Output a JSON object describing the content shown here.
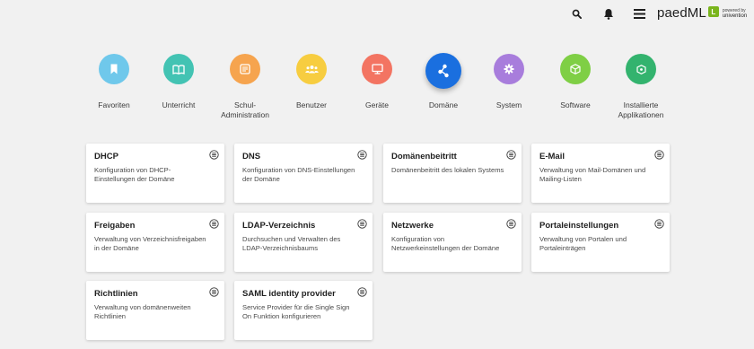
{
  "header": {
    "logo_text": "paedML",
    "logo_badge": "L",
    "powered_line1": "powered by",
    "powered_line2": "univention"
  },
  "categories": [
    {
      "label": "Favoriten",
      "color": "#6fc8eb",
      "icon": "bookmark-icon"
    },
    {
      "label": "Unterricht",
      "color": "#43c3b3",
      "icon": "book-icon"
    },
    {
      "label": "Schul-\nAdministration",
      "color": "#f6a44e",
      "icon": "admin-icon"
    },
    {
      "label": "Benutzer",
      "color": "#f7cd40",
      "icon": "users-icon"
    },
    {
      "label": "Geräte",
      "color": "#f37462",
      "icon": "monitor-icon"
    },
    {
      "label": "Domäne",
      "color": "#1a6fdf",
      "icon": "share-icon",
      "active": true
    },
    {
      "label": "System",
      "color": "#a87ddc",
      "icon": "gear-icon"
    },
    {
      "label": "Software",
      "color": "#7fcf45",
      "icon": "box-icon"
    },
    {
      "label": "Installierte\nApplikationen",
      "color": "#33b36e",
      "icon": "app-icon"
    }
  ],
  "tiles": [
    {
      "title": "DHCP",
      "desc": "Konfiguration von DHCP-Einstellungen der Domäne"
    },
    {
      "title": "DNS",
      "desc": "Konfiguration von DNS-Einstellungen der Domäne"
    },
    {
      "title": "Domänenbeitritt",
      "desc": "Domänenbeitritt des lokalen Systems"
    },
    {
      "title": "E-Mail",
      "desc": "Verwaltung von Mail-Domänen und Mailing-Listen"
    },
    {
      "title": "Freigaben",
      "desc": "Verwaltung von Verzeichnisfreigaben in der Domäne"
    },
    {
      "title": "LDAP-Verzeichnis",
      "desc": "Durchsuchen und Verwalten des LDAP-Verzeichnisbaums"
    },
    {
      "title": "Netzwerke",
      "desc": "Konfiguration von Netzwerkeinstellungen der Domäne"
    },
    {
      "title": "Portaleinstellungen",
      "desc": "Verwaltung von Portalen und Portaleinträgen"
    },
    {
      "title": "Richtlinien",
      "desc": "Verwaltung von domänenweiten Richtlinien"
    },
    {
      "title": "SAML identity provider",
      "desc": "Service Provider für die Single Sign On Funktion konfigurieren"
    }
  ]
}
